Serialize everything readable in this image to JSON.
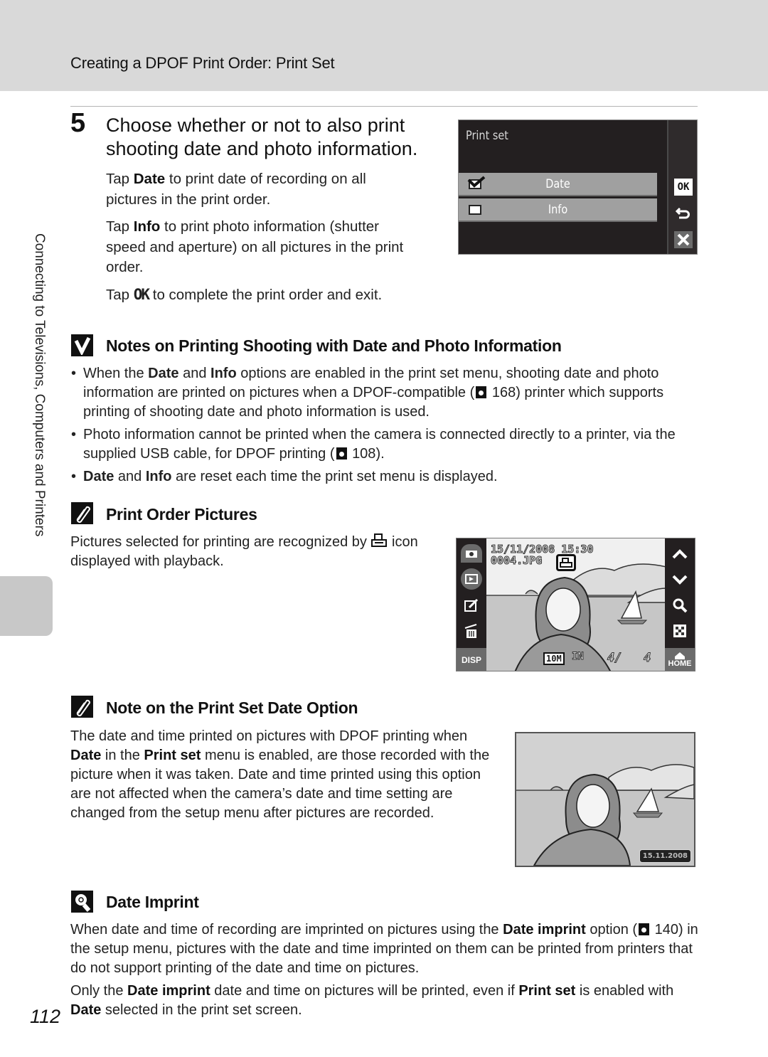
{
  "header": {
    "title": "Creating a DPOF Print Order: Print Set"
  },
  "side_tab": {
    "label": "Connecting to Televisions, Computers and Printers"
  },
  "step": {
    "number": "5",
    "title": "Choose whether or not to also print shooting date and photo information.",
    "p1_pre": "Tap ",
    "p1_bold": "Date",
    "p1_post": " to print date of recording on all pictures in the print order.",
    "p2_pre": "Tap ",
    "p2_bold": "Info",
    "p2_post": " to print photo information (shutter speed and aperture) on all pictures in the print order.",
    "p3_pre": "Tap ",
    "p3_icon": "OK",
    "p3_post": " to complete the print order and exit."
  },
  "print_set_screen": {
    "title": "Print set",
    "options": [
      {
        "label": "Date",
        "checked": true
      },
      {
        "label": "Info",
        "checked": false
      }
    ],
    "side_buttons": {
      "ok": "OK",
      "back": "back-arrow",
      "close": "close-x"
    }
  },
  "notes": {
    "heading": "Notes on Printing Shooting with Date and Photo Information",
    "bullets": [
      {
        "pre": "When the ",
        "b1": "Date",
        "mid": " and ",
        "b2": "Info",
        "post1": " options are enabled in the print set menu, shooting date and photo information are printed on pictures when a DPOF-compatible (",
        "ref": "168",
        "post2": ") printer which supports printing of shooting date and photo information is used."
      },
      {
        "pre": "Photo information cannot be printed when the camera is connected directly to a printer, via the supplied USB cable, for DPOF printing (",
        "ref": "108",
        "post": ")."
      },
      {
        "b1": "Date",
        "mid": " and ",
        "b2": "Info",
        "post": " are reset each time the print set menu is displayed."
      }
    ]
  },
  "print_order_pictures": {
    "heading": "Print Order Pictures",
    "text_pre": "Pictures selected for printing are recognized by ",
    "text_post": " icon displayed with playback."
  },
  "playback_screen": {
    "datetime": "15/11/2008 15:30",
    "filename": "0004.JPG",
    "image_size": "10M",
    "memory": "IN",
    "frame_counter": "4/   4",
    "disp_label": "DISP",
    "home_label": "HOME"
  },
  "date_option_note": {
    "heading": "Note on the Print Set Date Option",
    "line1": "The date and time printed on pictures with DPOF printing when",
    "b1": "Date",
    "mid1": " in the ",
    "b2": "Print set",
    "post1": " menu is enabled, are those recorded with the picture when it was taken. Date and time printed using this option are not affected when the camera’s date and time setting are changed from the setup menu after pictures are recorded."
  },
  "sample_photo": {
    "date_stamp": "15.11.2008"
  },
  "date_imprint": {
    "heading": "Date Imprint",
    "p1_pre": "When date and time of recording are imprinted on pictures using the ",
    "p1_b": "Date imprint",
    "p1_mid": " option (",
    "p1_ref": "140",
    "p1_post": ") in the setup menu, pictures with the date and time imprinted on them can be printed from printers that do not support printing of the date and time on pictures.",
    "p2_pre": "Only the ",
    "p2_b1": "Date imprint",
    "p2_mid": " date and time on pictures will be printed, even if ",
    "p2_b2": "Print set",
    "p2_mid2": " is enabled with ",
    "p2_b3": "Date",
    "p2_post": " selected in the print set screen."
  },
  "page_number": "112"
}
